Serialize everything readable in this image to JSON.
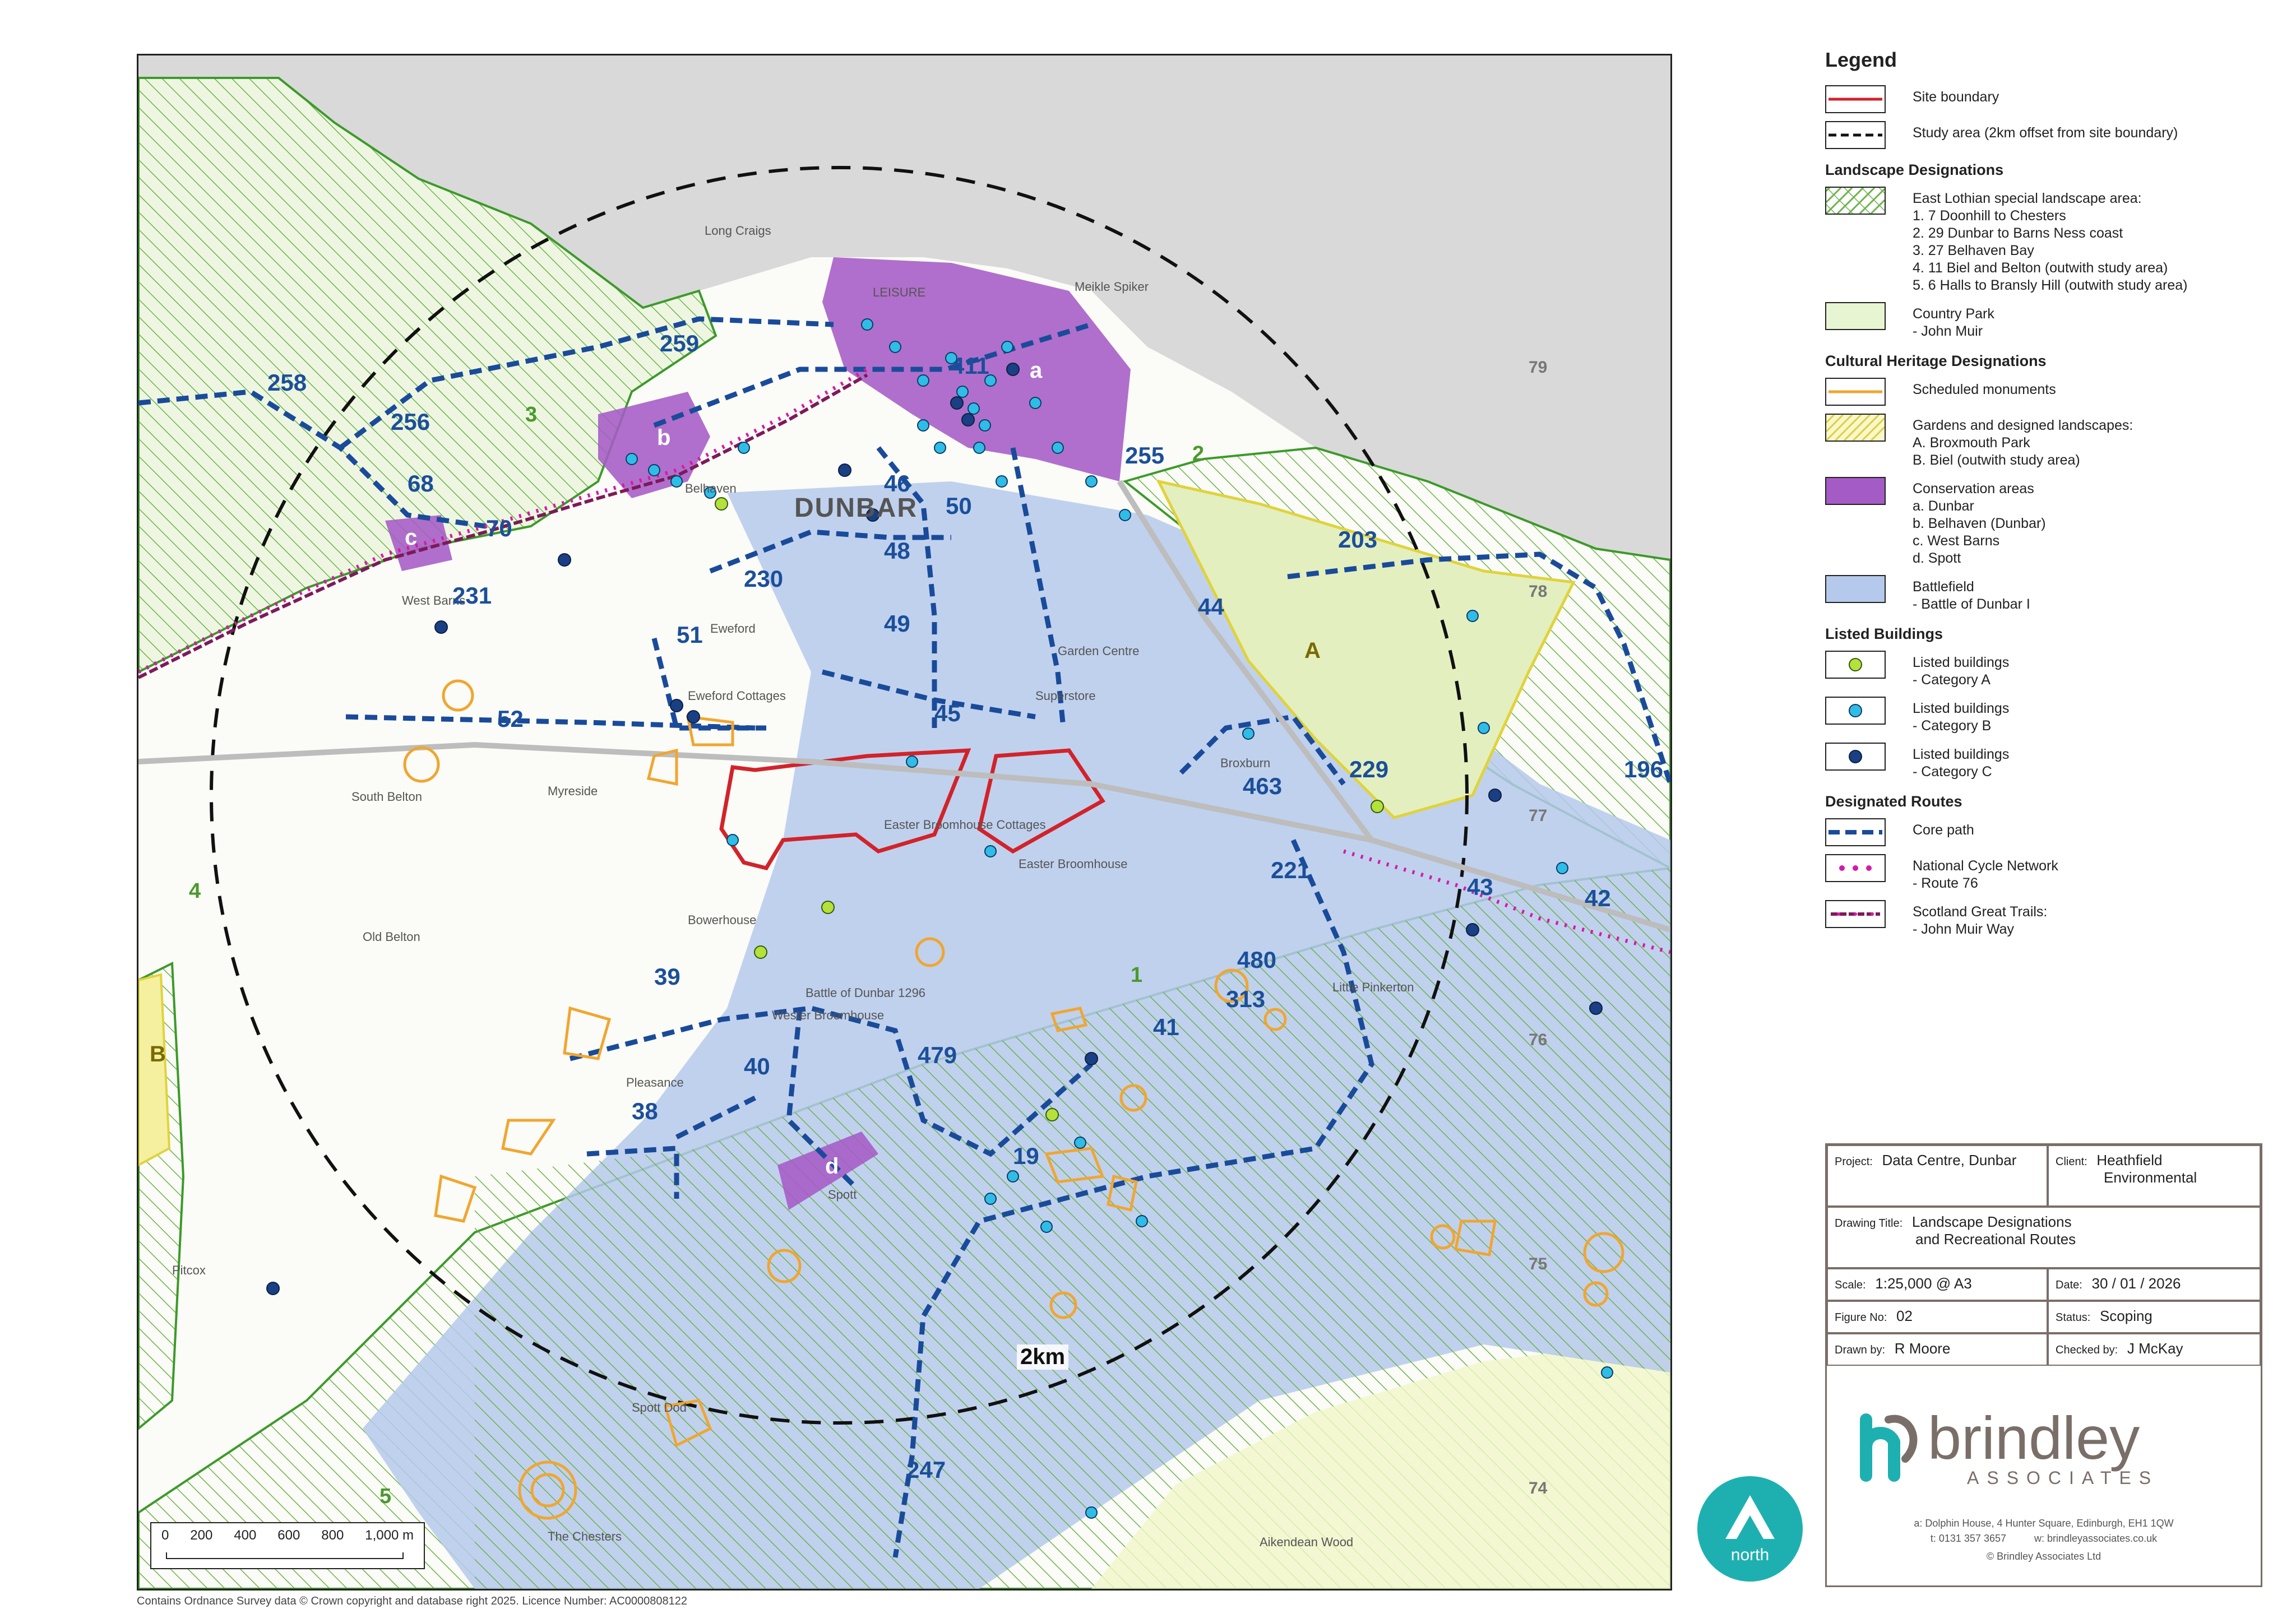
{
  "map": {
    "site_boundary_color": "#d2232a",
    "study_area_label": "2km",
    "grid_numbers": [
      "79",
      "78",
      "77",
      "76",
      "75",
      "74"
    ],
    "route_labels": [
      "258",
      "256",
      "68",
      "70",
      "231",
      "259",
      "411",
      "255",
      "46",
      "50",
      "48",
      "230",
      "49",
      "51",
      "52",
      "45",
      "44",
      "203",
      "229",
      "463",
      "221",
      "43",
      "42",
      "196",
      "39",
      "40",
      "38",
      "479",
      "480",
      "313",
      "41",
      "19",
      "247"
    ],
    "conservation_letters": [
      "a",
      "b",
      "c",
      "d"
    ],
    "garden_letters": [
      "A",
      "B"
    ],
    "landscape_numbers": [
      "1",
      "2",
      "3",
      "4",
      "5"
    ],
    "place_names": {
      "dunbar": "DUNBAR",
      "belhaven": "Belhaven",
      "west_barns": "West Barns",
      "eweford": "Eweford",
      "eweford_cottages": "Eweford Cottages",
      "easter_broomhouse_cottages": "Easter Broomhouse Cottages",
      "easter_broomhouse": "Easter Broomhouse",
      "wester_broomhouse": "Wester Broomhouse",
      "broxburn": "Broxburn",
      "spott": "Spott",
      "pleasance": "Pleasance",
      "south_belton": "South Belton",
      "myreside": "Myreside",
      "bowerhouse": "Bowerhouse",
      "old_belton": "Old Belton",
      "pitcox": "Pitcox",
      "little_pinkerton": "Little Pinkerton",
      "the_chesters": "The Chesters",
      "spott_dod": "Spott Dod",
      "aikendean_wood": "Aikendean Wood",
      "long_craigs": "Long Craigs",
      "meikle_spiker": "Meikle Spiker",
      "battle_of_dunbar": "Battle of Dunbar 1296",
      "supetstore": "Superstore",
      "garden_centre": "Garden Centre",
      "leisure": "LEISURE"
    }
  },
  "scale_bar": {
    "ticks": [
      "0",
      "200",
      "400",
      "600",
      "800",
      "1,000 m"
    ]
  },
  "attribution": "Contains Ordnance Survey data © Crown copyright and database right 2025. Licence Number: AC0000808122",
  "legend": {
    "title": "Legend",
    "items_top": [
      {
        "label": "Site boundary",
        "kind": "line-red"
      },
      {
        "label": "Study area (2km offset from site boundary)",
        "kind": "line-dash"
      }
    ],
    "landscape_title": "Landscape Designations",
    "landscape_items": [
      {
        "kind": "hatch-green",
        "lines": [
          "East Lothian special landscape area:",
          "1. 7 Doonhill to Chesters",
          "2. 29 Dunbar to Barns Ness coast",
          "3. 27 Belhaven Bay",
          "4. 11 Biel and Belton (outwith study area)",
          "5. 6 Halls to Bransly Hill (outwith study area)"
        ]
      },
      {
        "kind": "fill-lightgreen",
        "lines": [
          "Country Park",
          "- John Muir"
        ]
      }
    ],
    "heritage_title": "Cultural Heritage Designations",
    "heritage_items": [
      {
        "kind": "line-orange",
        "lines": [
          "Scheduled monuments"
        ]
      },
      {
        "kind": "hatch-yellow",
        "lines": [
          "Gardens and designed landscapes:",
          "A. Broxmouth Park",
          "B. Biel (outwith study area)"
        ]
      },
      {
        "kind": "fill-purple",
        "lines": [
          "Conservation areas",
          "a. Dunbar",
          "b. Belhaven (Dunbar)",
          "c. West Barns",
          "d. Spott"
        ]
      },
      {
        "kind": "fill-blue",
        "lines": [
          "Battlefield",
          "- Battle of Dunbar I"
        ]
      }
    ],
    "listed_title": "Listed Buildings",
    "listed_items": [
      {
        "kind": "dot-lime",
        "lines": [
          "Listed buildings",
          "- Category A"
        ]
      },
      {
        "kind": "dot-cyan",
        "lines": [
          "Listed buildings",
          "- Category B"
        ]
      },
      {
        "kind": "dot-navy",
        "lines": [
          "Listed buildings",
          "- Category C"
        ]
      }
    ],
    "routes_title": "Designated Routes",
    "routes_items": [
      {
        "kind": "line-core",
        "lines": [
          "Core path"
        ]
      },
      {
        "kind": "line-ncn",
        "lines": [
          "National Cycle Network",
          "- Route 76"
        ]
      },
      {
        "kind": "line-sgt",
        "lines": [
          "Scotland Great Trails:",
          "- John Muir Way"
        ]
      }
    ]
  },
  "title_block": {
    "project_key": "Project:",
    "project_value": "Data Centre, Dunbar",
    "client_key": "Client:",
    "client_value_1": "Heathfield",
    "client_value_2": "Environmental",
    "drawing_title_key": "Drawing Title:",
    "drawing_title_1": "Landscape Designations",
    "drawing_title_2": "and Recreational Routes",
    "scale_key": "Scale:",
    "scale_value": "1:25,000 @ A3",
    "date_key": "Date:",
    "date_value": "30 / 01 / 2026",
    "figure_key": "Figure No:",
    "figure_value": "02",
    "status_key": "Status:",
    "status_value": "Scoping",
    "drawn_key": "Drawn by:",
    "drawn_value": "R Moore",
    "checked_key": "Checked by:",
    "checked_value": "J McKay",
    "company": "brindley",
    "company_sub": "ASSOCIATES",
    "address": "a: Dolphin House, 4 Hunter Square, Edinburgh, EH1 1QW",
    "phone": "t: 0131 357 3657",
    "web": "w: brindleyassociates.co.uk",
    "copyright": "© Brindley Associates Ltd",
    "north_label": "north",
    "brand_color": "#1eb0b0",
    "text_color": "#7a6e68"
  }
}
